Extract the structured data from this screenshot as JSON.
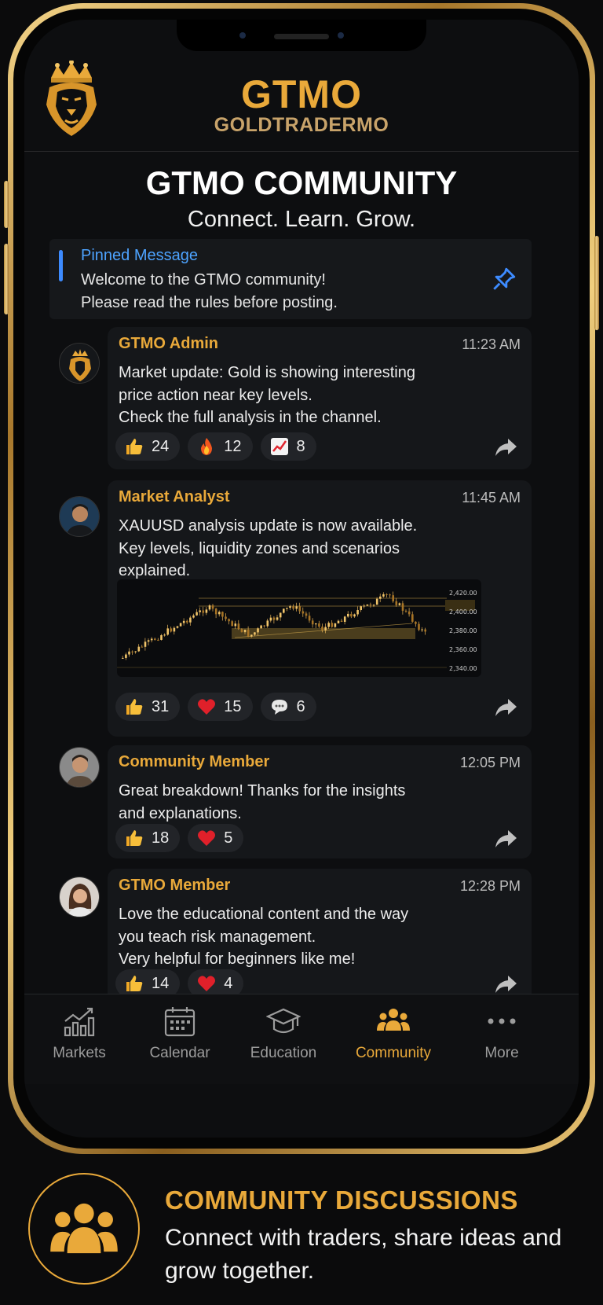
{
  "header": {
    "title": "GTMO",
    "subtitle": "GOLDTRADERMO"
  },
  "community": {
    "title": "GTMO COMMUNITY",
    "tagline": "Connect. Learn. Grow."
  },
  "pinned": {
    "label": "Pinned Message",
    "text": "Welcome to the GTMO community!\nPlease read the rules before posting."
  },
  "posts": [
    {
      "author": "GTMO Admin",
      "time": "11:23 AM",
      "text": "Market update: Gold is showing interesting\nprice action near key levels.\nCheck the full analysis in the channel.",
      "reactions": [
        {
          "icon": "thumbs-up-icon",
          "count": "24"
        },
        {
          "icon": "fire-icon",
          "count": "12"
        },
        {
          "icon": "chart-increasing-icon",
          "count": "8"
        }
      ]
    },
    {
      "author": "Market Analyst",
      "time": "11:45 AM",
      "text": "XAUUSD analysis update is now available.\nKey levels, liquidity zones and scenarios\nexplained.",
      "chart_price_labels": [
        "2,420.00",
        "2,400.00",
        "2,380.00",
        "2,360.00",
        "2,340.00"
      ],
      "reactions": [
        {
          "icon": "thumbs-up-icon",
          "count": "31"
        },
        {
          "icon": "heart-icon",
          "count": "15"
        },
        {
          "icon": "speech-bubble-icon",
          "count": "6"
        }
      ]
    },
    {
      "author": "Community Member",
      "time": "12:05 PM",
      "text": "Great breakdown! Thanks for the insights\nand explanations.",
      "reactions": [
        {
          "icon": "thumbs-up-icon",
          "count": "18"
        },
        {
          "icon": "heart-icon",
          "count": "5"
        }
      ]
    },
    {
      "author": "GTMO Member",
      "time": "12:28 PM",
      "text": "Love the educational content and the way\nyou teach risk management.\nVery helpful for beginners like me!",
      "reactions": [
        {
          "icon": "thumbs-up-icon",
          "count": "14"
        },
        {
          "icon": "heart-icon",
          "count": "4"
        }
      ]
    }
  ],
  "tabs": [
    {
      "label": "Markets",
      "icon": "bar-chart-icon"
    },
    {
      "label": "Calendar",
      "icon": "calendar-icon"
    },
    {
      "label": "Education",
      "icon": "graduation-cap-icon"
    },
    {
      "label": "Community",
      "icon": "people-icon",
      "active": true
    },
    {
      "label": "More",
      "icon": "more-dots-icon"
    }
  ],
  "promo": {
    "title": "COMMUNITY DISCUSSIONS",
    "text": "Connect with traders, share ideas and grow together."
  },
  "colors": {
    "gold": "#e9a93a",
    "link_blue": "#4da3ff",
    "background": "#0d0e10",
    "card": "#15171a"
  }
}
